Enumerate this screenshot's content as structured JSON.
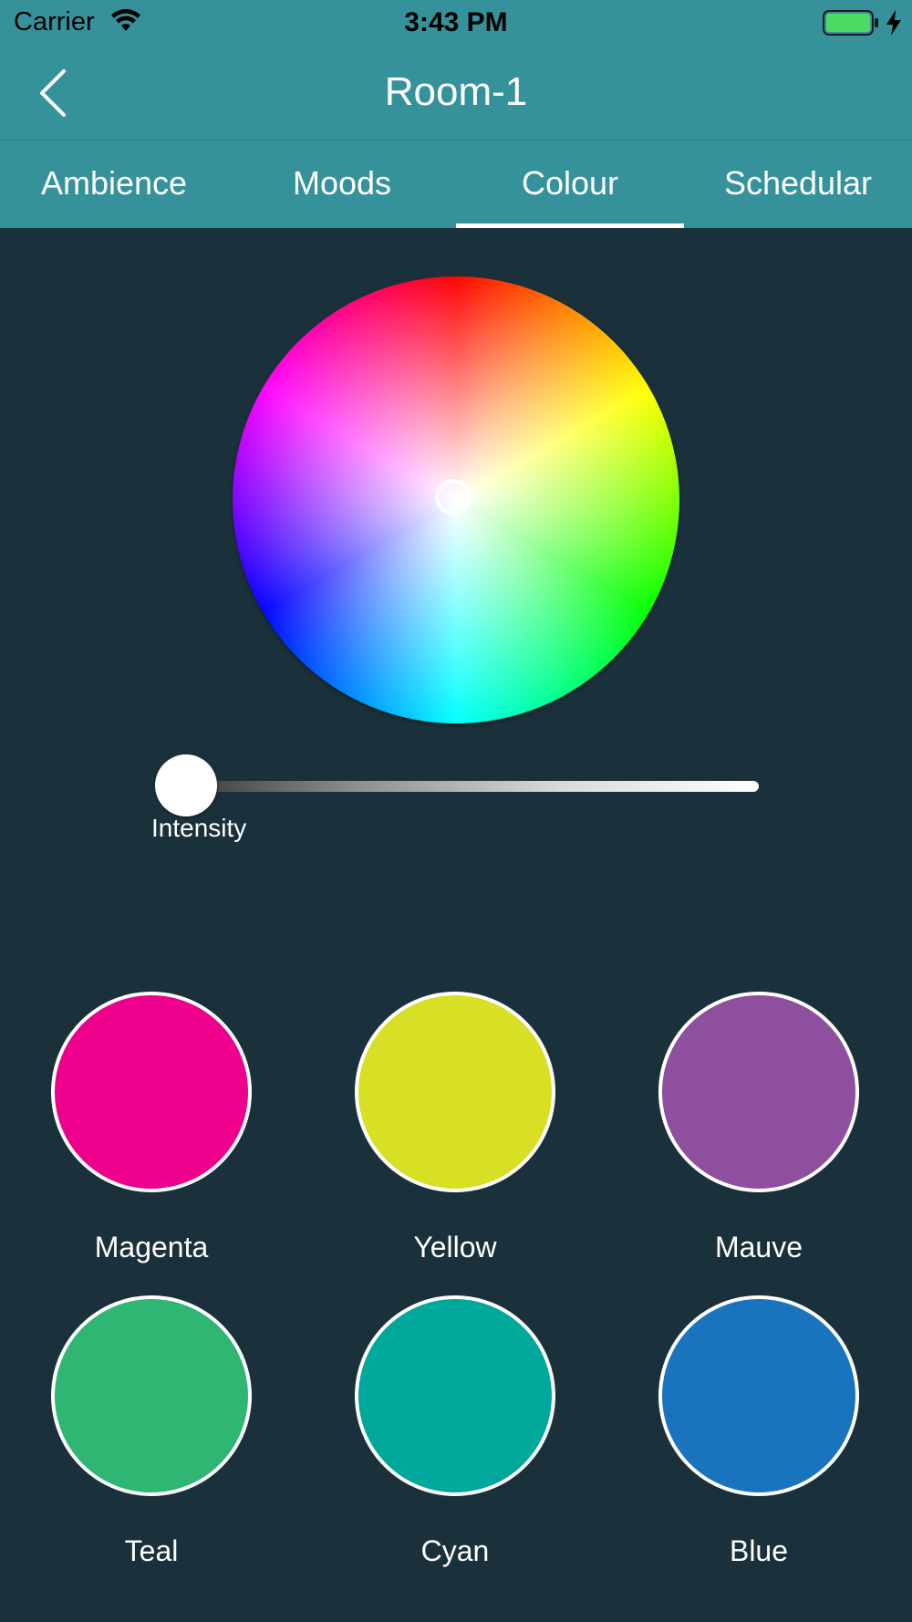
{
  "status_bar": {
    "carrier": "Carrier",
    "time": "3:43 PM",
    "battery_color": "#4cd964"
  },
  "nav": {
    "title": "Room-1",
    "back_icon": "chevron-left-icon"
  },
  "tabs": [
    {
      "label": "Ambience",
      "selected": false
    },
    {
      "label": "Moods",
      "selected": false
    },
    {
      "label": "Colour",
      "selected": true
    },
    {
      "label": "Schedular",
      "selected": false
    }
  ],
  "intensity": {
    "label": "Intensity",
    "value": 0.0
  },
  "presets": [
    {
      "label": "Magenta",
      "color": "#ec008c"
    },
    {
      "label": "Yellow",
      "color": "#d7e024"
    },
    {
      "label": "Mauve",
      "color": "#8d4f9e"
    },
    {
      "label": "Teal",
      "color": "#2fb672"
    },
    {
      "label": "Cyan",
      "color": "#00a89c"
    },
    {
      "label": "Blue",
      "color": "#1a74bd"
    }
  ],
  "colors": {
    "header": "#36929a",
    "background": "#1a313b"
  }
}
